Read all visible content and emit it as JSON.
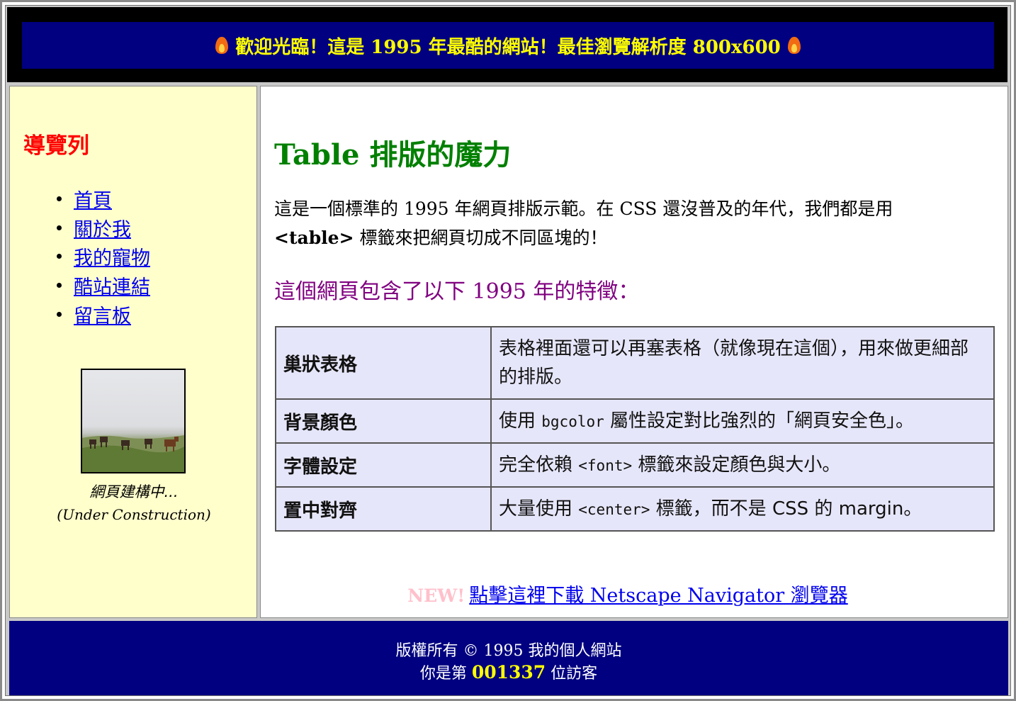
{
  "header": {
    "banner_text": "歡迎光臨！這是 1995 年最酷的網站！最佳瀏覽解析度 800x600",
    "left_icon": "fire-icon",
    "right_icon": "fire-icon"
  },
  "sidebar": {
    "title": "導覽列",
    "items": [
      {
        "label": "首頁"
      },
      {
        "label": "關於我"
      },
      {
        "label": "我的寵物"
      },
      {
        "label": "酷站連結"
      },
      {
        "label": "留言板"
      }
    ],
    "caption": "網頁建構中...",
    "caption_en": "(Under Construction)"
  },
  "main": {
    "title": "Table 排版的魔力",
    "intro_part1": "這是一個標準的 1995 年網頁排版示範。在 CSS 還沒普及的年代，我們都是用",
    "intro_tag": "<table>",
    "intro_part2": " 標籤來把網頁切成不同區塊的！",
    "subtitle": "這個網頁包含了以下 1995 年的特徵：",
    "features": [
      {
        "name": "巢狀表格",
        "desc_before": "表格裡面還可以再塞表格（就像現在這個），用來做更細部的排版。",
        "code": "",
        "desc_after": ""
      },
      {
        "name": "背景顏色",
        "desc_before": "使用 ",
        "code": "bgcolor",
        "desc_after": " 屬性設定對比強烈的「網頁安全色」。"
      },
      {
        "name": "字體設定",
        "desc_before": "完全依賴 ",
        "code": "<font>",
        "desc_after": " 標籤來設定顏色與大小。"
      },
      {
        "name": "置中對齊",
        "desc_before": "大量使用 ",
        "code": "<center>",
        "desc_after": " 標籤，而不是 CSS 的 margin。"
      }
    ],
    "new_label": "NEW!",
    "download_link": "點擊這裡下載 Netscape Navigator 瀏覽器"
  },
  "footer": {
    "copyright": "版權所有 © 1995 我的個人網站",
    "visitor_prefix": "你是第 ",
    "visitor_count": "001337",
    "visitor_suffix": " 位訪客"
  },
  "colors": {
    "header_bg": "#000080",
    "header_text": "#ffff00",
    "sidebar_bg": "#ffffcc",
    "nav_title": "#ff0000",
    "main_title": "#008000",
    "subtitle": "#800080",
    "table_bg": "#e6e6fa",
    "link": "#0000ee",
    "footer_bg": "#000080"
  }
}
